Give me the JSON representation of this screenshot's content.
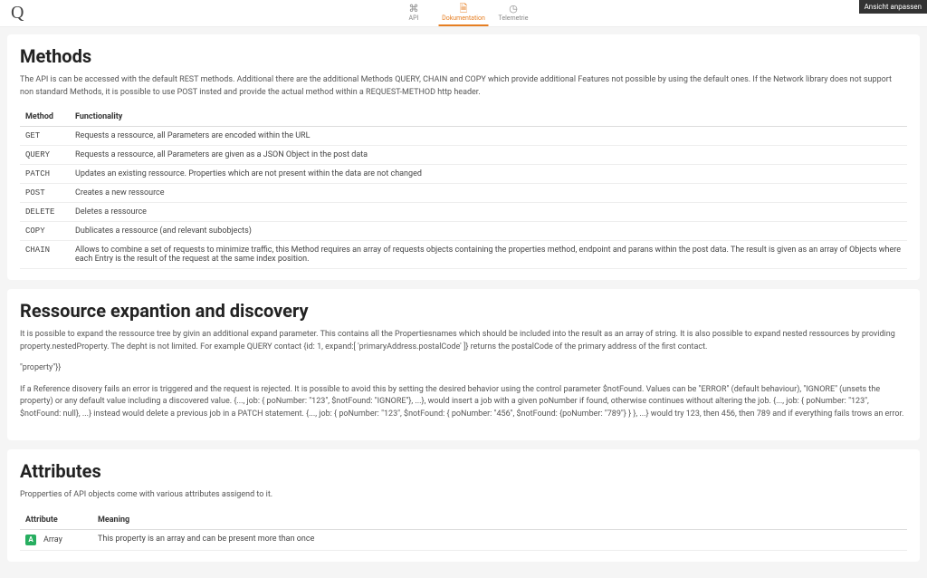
{
  "brand": "Q",
  "nav": {
    "api": "API",
    "doc": "Dokumentation",
    "tel": "Telemetrie"
  },
  "topButton": "Ansicht anpassen",
  "methods": {
    "title": "Methods",
    "intro": "The API is can be accessed with the default REST methods. Additional there are the additional Methods QUERY, CHAIN and COPY which provide additional Features not possible by using the default ones. If the Network library does not support non standard Methods, it is possible to use POST insted and provide the actual method within a REQUEST-METHOD http header.",
    "th1": "Method",
    "th2": "Functionality",
    "rows": [
      {
        "m": "GET",
        "f": "Requests a ressource, all Parameters are encoded within the URL"
      },
      {
        "m": "QUERY",
        "f": "Requests a ressource, all Parameters are given as a JSON Object in the post data"
      },
      {
        "m": "PATCH",
        "f": "Updates an existing ressource. Properties which are not present within the data are not changed"
      },
      {
        "m": "POST",
        "f": "Creates a new ressource"
      },
      {
        "m": "DELETE",
        "f": "Deletes a ressource"
      },
      {
        "m": "COPY",
        "f": "Dublicates a ressource (and relevant subobjects)"
      },
      {
        "m": "CHAIN",
        "f": "Allows to combine a set of requests to minimize traffic, this Method requires an array of requests objects containing the properties method, endpoint and parans within the post data. The result is given as an array of Objects where each Entry is the result of the request at the same index position."
      }
    ]
  },
  "expansion": {
    "title": "Ressource expantion and discovery",
    "p1": "It is possible to expand the ressource tree by givin an additional expand parameter. This contains all the Propertiesnames which should be included into the result as an array of string. It is also possible to expand nested ressources by providing property.nestedProperty. The depht is not limited. For example QUERY contact {id: 1, expand:[ 'primaryAddress.postalCode' ]} returns the postalCode of the primary address of the first contact.",
    "p2": "\"property\"}}",
    "p3": "If a Reference disovery fails an error is triggered and the request is rejected. It is possible to avoid this by setting the desired behavior using the control parameter $notFound. Values can be \"ERROR\" (default behaviour), \"IGNORE\" (unsets the property) or any default value including a discovered value. {..., job: { poNumber: \"123\", $notFound: \"IGNORE\"}, ...}, would insert a job with a given poNumber if found, otherwise continues without altering the job. {..., job: { poNumber: \"123\", $notFound: null}, ...} instead would delete a previous job in a PATCH statement. {..., job: { poNumber: \"123\", $notFound: { poNumber: \"456\", $notFound: {poNumber: \"789\"} } }, ...} would try 123, then 456, then 789 and if everything fails trows an error."
  },
  "attributes": {
    "title": "Attributes",
    "intro": "Propperties of API objects come with various attributes assigend to it.",
    "th1": "Attribute",
    "th2": "Meaning",
    "rows": [
      {
        "badge": "A",
        "name": "Array",
        "desc": "This property is an array and can be present more than once"
      }
    ]
  }
}
